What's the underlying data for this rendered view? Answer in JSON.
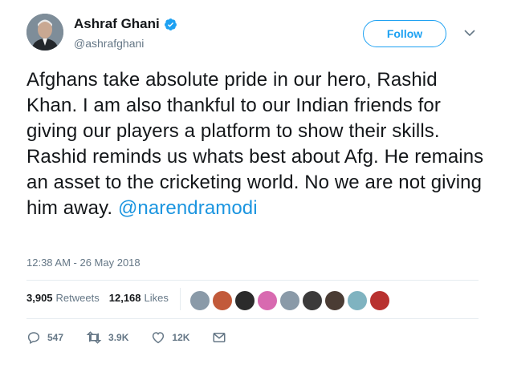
{
  "author": {
    "name": "Ashraf Ghani",
    "handle": "@ashrafghani",
    "verified": true
  },
  "follow_label": "Follow",
  "tweet": {
    "text": "Afghans take absolute pride in our hero, Rashid Khan. I am also thankful to our Indian friends for giving our players a platform to show their skills. Rashid reminds us whats best about Afg. He remains an asset to the cricketing world. No we are not giving him away.",
    "mention": "@narendramodi",
    "timestamp": "12:38 AM - 26 May 2018"
  },
  "stats": {
    "retweets_count": "3,905",
    "retweets_label": "Retweets",
    "likes_count": "12,168",
    "likes_label": "Likes"
  },
  "likers": [
    {
      "color": "#8a9aa8"
    },
    {
      "color": "#c25a3a"
    },
    {
      "color": "#2b2b2b"
    },
    {
      "color": "#d86ab0"
    },
    {
      "color": "#8a9aa8"
    },
    {
      "color": "#3b3a3a"
    },
    {
      "color": "#4a3c34"
    },
    {
      "color": "#7fb3c0"
    },
    {
      "color": "#b8312f"
    }
  ],
  "actions": {
    "replies": "547",
    "retweets": "3.9K",
    "likes": "12K"
  },
  "colors": {
    "accent": "#1da1f2",
    "link": "#1b95e0",
    "muted": "#657786"
  }
}
